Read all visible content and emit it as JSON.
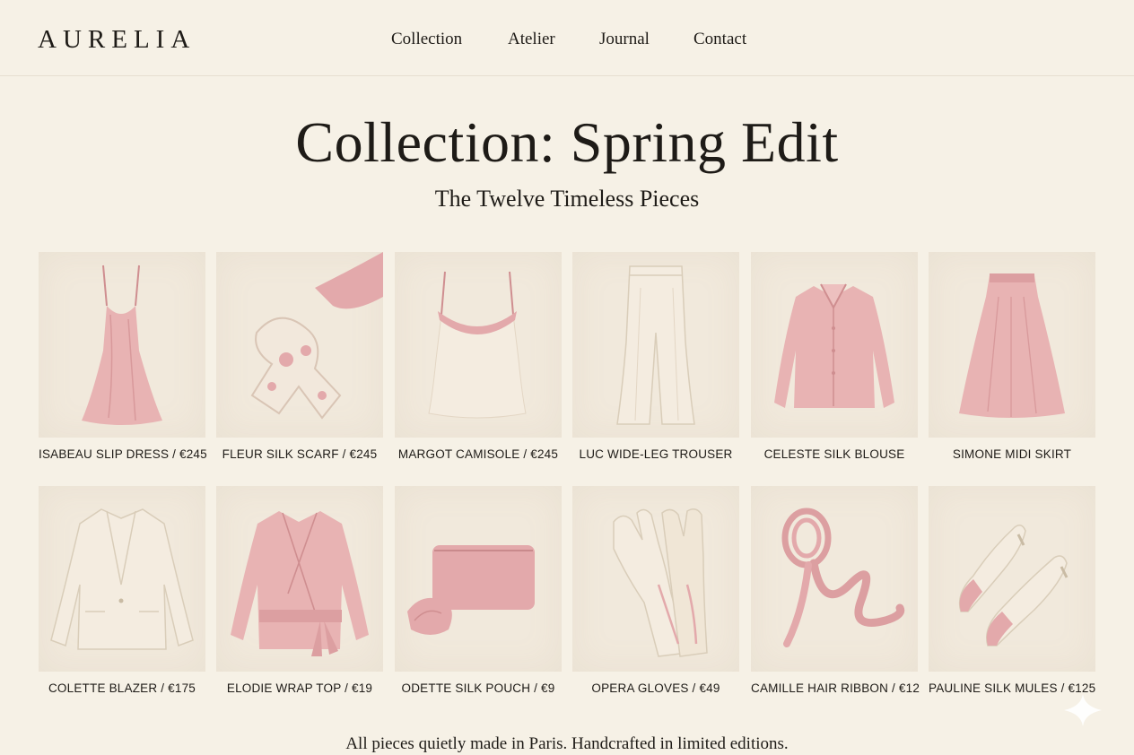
{
  "brand": {
    "name": "AURELIA"
  },
  "nav": [
    {
      "label": "Collection"
    },
    {
      "label": "Atelier"
    },
    {
      "label": "Journal"
    },
    {
      "label": "Contact"
    }
  ],
  "hero": {
    "title": "Collection: Spring Edit",
    "subtitle": "The Twelve Timeless Pieces"
  },
  "products": [
    {
      "caption": "ISABEAU SLIP DRESS / €245",
      "icon": "slip-dress"
    },
    {
      "caption": "FLEUR SILK SCARF / €245",
      "icon": "silk-scarf"
    },
    {
      "caption": "MARGOT CAMISOLE / €245",
      "icon": "camisole"
    },
    {
      "caption": "LUC WIDE-LEG TROUSER",
      "icon": "trouser"
    },
    {
      "caption": "CELESTE SILK BLOUSE",
      "icon": "blouse"
    },
    {
      "caption": "SIMONE MIDI SKIRT",
      "icon": "skirt"
    },
    {
      "caption": "COLETTE BLAZER / €175",
      "icon": "blazer"
    },
    {
      "caption": "ELODIE WRAP TOP / €19",
      "icon": "wrap-top"
    },
    {
      "caption": "ODETTE SILK POUCH / €9",
      "icon": "pouch"
    },
    {
      "caption": "OPERA GLOVES / €49",
      "icon": "gloves"
    },
    {
      "caption": "CAMILLE HAIR RIBBON / €12",
      "icon": "ribbon"
    },
    {
      "caption": "PAULINE SILK MULES / €125",
      "icon": "mules"
    }
  ],
  "footer": {
    "text": "All pieces quietly made in Paris. Handcrafted in limited editions."
  },
  "colors": {
    "background": "#f6f1e6",
    "tile": "#f1e9dc",
    "blush": "#e3a9ab",
    "blush_dark": "#cf8e90",
    "ivory": "#f4ece0",
    "ivory_edge": "#d9cdb9",
    "ink": "#1e1b17"
  }
}
